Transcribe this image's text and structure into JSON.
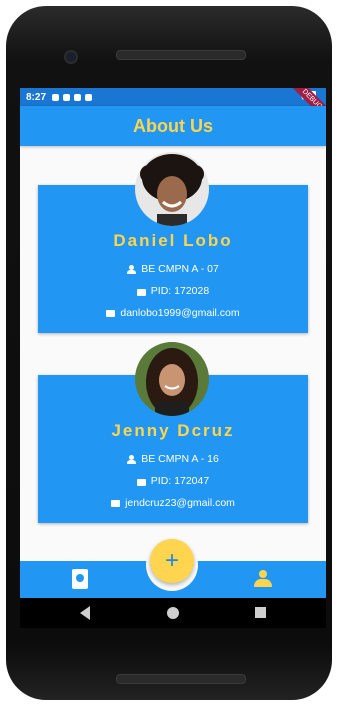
{
  "status_bar": {
    "time": "8:27",
    "debug_banner": "DEBUG"
  },
  "app_bar": {
    "title": "About Us"
  },
  "members": [
    {
      "name": "Daniel Lobo",
      "class": "BE CMPN A - 07",
      "pid": "PID: 172028",
      "email": "danlobo1999@gmail.com"
    },
    {
      "name": "Jenny Dcruz",
      "class": "BE CMPN A - 16",
      "pid": "PID: 172047",
      "email": "jendcruz23@gmail.com"
    }
  ],
  "fab": {
    "label": "+"
  },
  "colors": {
    "primary": "#2196f3",
    "accent": "#ffd54f",
    "status": "#1976d2"
  },
  "icons": {
    "nav_left": "contacts-icon",
    "nav_right": "person-icon",
    "fab": "add-icon"
  }
}
